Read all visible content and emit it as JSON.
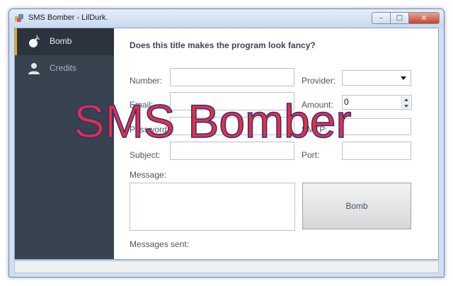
{
  "window": {
    "title": "SMS Bomber - LilDurk.",
    "controls": {
      "minimize": "–",
      "maximize": "□",
      "close": "✕"
    }
  },
  "sidebar": {
    "items": [
      {
        "label": "Bomb",
        "icon": "bomb-icon",
        "active": true
      },
      {
        "label": "Credits",
        "icon": "person-icon",
        "active": false
      }
    ],
    "accent_color": "#f0a21c"
  },
  "form": {
    "heading": "Does this title makes the program look fancy?",
    "number_label": "Number:",
    "number_value": "",
    "provider_label": "Provider:",
    "provider_value": "",
    "email_label": "Email:",
    "email_value": "",
    "amount_label": "Amount:",
    "amount_value": "0",
    "password_label": "Password:",
    "password_value": "",
    "smtp_label": "SMTP:",
    "smtp_value": "",
    "subject_label": "Subject:",
    "subject_value": "",
    "port_label": "Port:",
    "port_value": "",
    "message_label": "Message:",
    "message_value": "",
    "bomb_button": "Bomb",
    "messages_sent_label": "Messages sent:"
  },
  "overlay": {
    "text": "SMS Bomber",
    "fill_color": "#e8303a",
    "stroke_color": "#2a2f8c"
  }
}
